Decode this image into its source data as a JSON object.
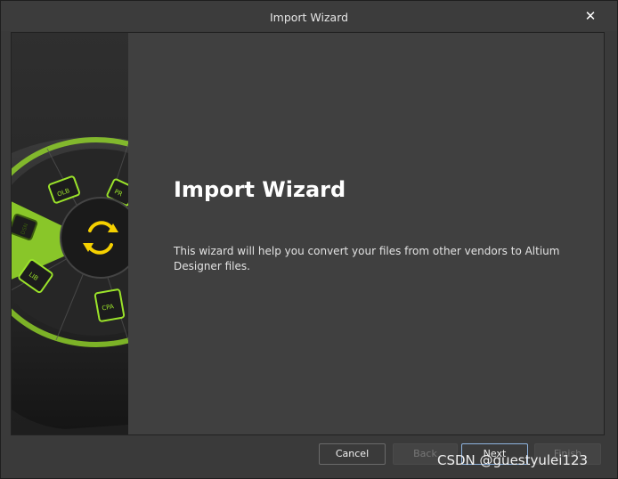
{
  "window": {
    "title": "Import Wizard",
    "close_glyph": "✕"
  },
  "main": {
    "heading": "Import Wizard",
    "description": "This wizard will help you convert your files from other vendors to Altium Designer files."
  },
  "art": {
    "icon_labels": [
      "OLB",
      "DSN",
      "LIB",
      "CPA",
      "PR"
    ],
    "center_icon": "sync-arrows-icon",
    "accent_color": "#9be32a"
  },
  "buttons": {
    "cancel": "Cancel",
    "back": "Back",
    "next": "Next",
    "finish": "Finish"
  },
  "watermark": "CSDN @guestyulei123"
}
